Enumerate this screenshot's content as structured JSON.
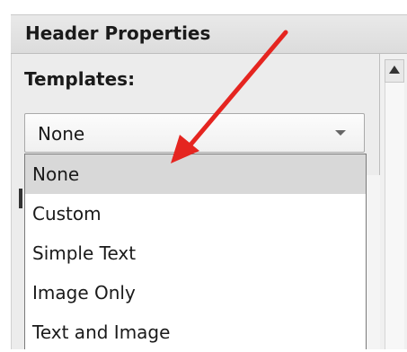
{
  "header": {
    "title": "Header Properties"
  },
  "templates": {
    "label": "Templates:",
    "selected_value": "None",
    "options": [
      {
        "label": "None",
        "selected": true
      },
      {
        "label": "Custom",
        "selected": false
      },
      {
        "label": "Simple Text",
        "selected": false
      },
      {
        "label": "Image Only",
        "selected": false
      },
      {
        "label": "Text and Image",
        "selected": false
      }
    ]
  },
  "annotation": {
    "arrow_color": "#e52520"
  },
  "icons": {
    "select_arrow": "chevron-down-icon",
    "scroll_up": "scroll-up-arrow-icon"
  }
}
